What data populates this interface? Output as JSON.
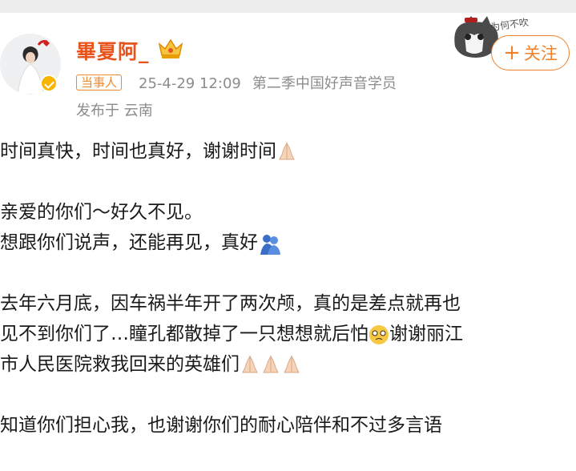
{
  "header": {
    "username": "畢夏阿_",
    "tag": "当事人",
    "date": "25-4-29 12:09",
    "source": "第二季中国好声音学员",
    "location": "发布于 云南",
    "follow_label": "关注",
    "follow_plus": "+",
    "cat_caption": "为何不吹"
  },
  "post": {
    "line1": "时间真快，时间也真好，谢谢时间",
    "line2": "亲爱的你们～好久不见。",
    "line3": "想跟你们说声，还能再见，真好",
    "line4": "去年六月底，因车祸半年开了两次颅，真的是差点就再也",
    "line5a": "见不到你们了…瞳孔都散掉了一只想想就后怕",
    "line5b": "谢谢丽江",
    "line6": "市人民医院救我回来的英雄们",
    "line7": "知道你们担心我，也谢谢你们的耐心陪伴和不过多言语"
  },
  "colors": {
    "brand": "#e8541e",
    "accent": "#f0812a",
    "meta": "#8c8c8c",
    "verify": "#f7b500"
  },
  "icons": [
    "avatar-photo",
    "verified-badge-icon",
    "crown-icon",
    "cat-sticker",
    "plus-icon",
    "praying-hands-emoji",
    "hug-emoji",
    "teary-face-emoji"
  ]
}
